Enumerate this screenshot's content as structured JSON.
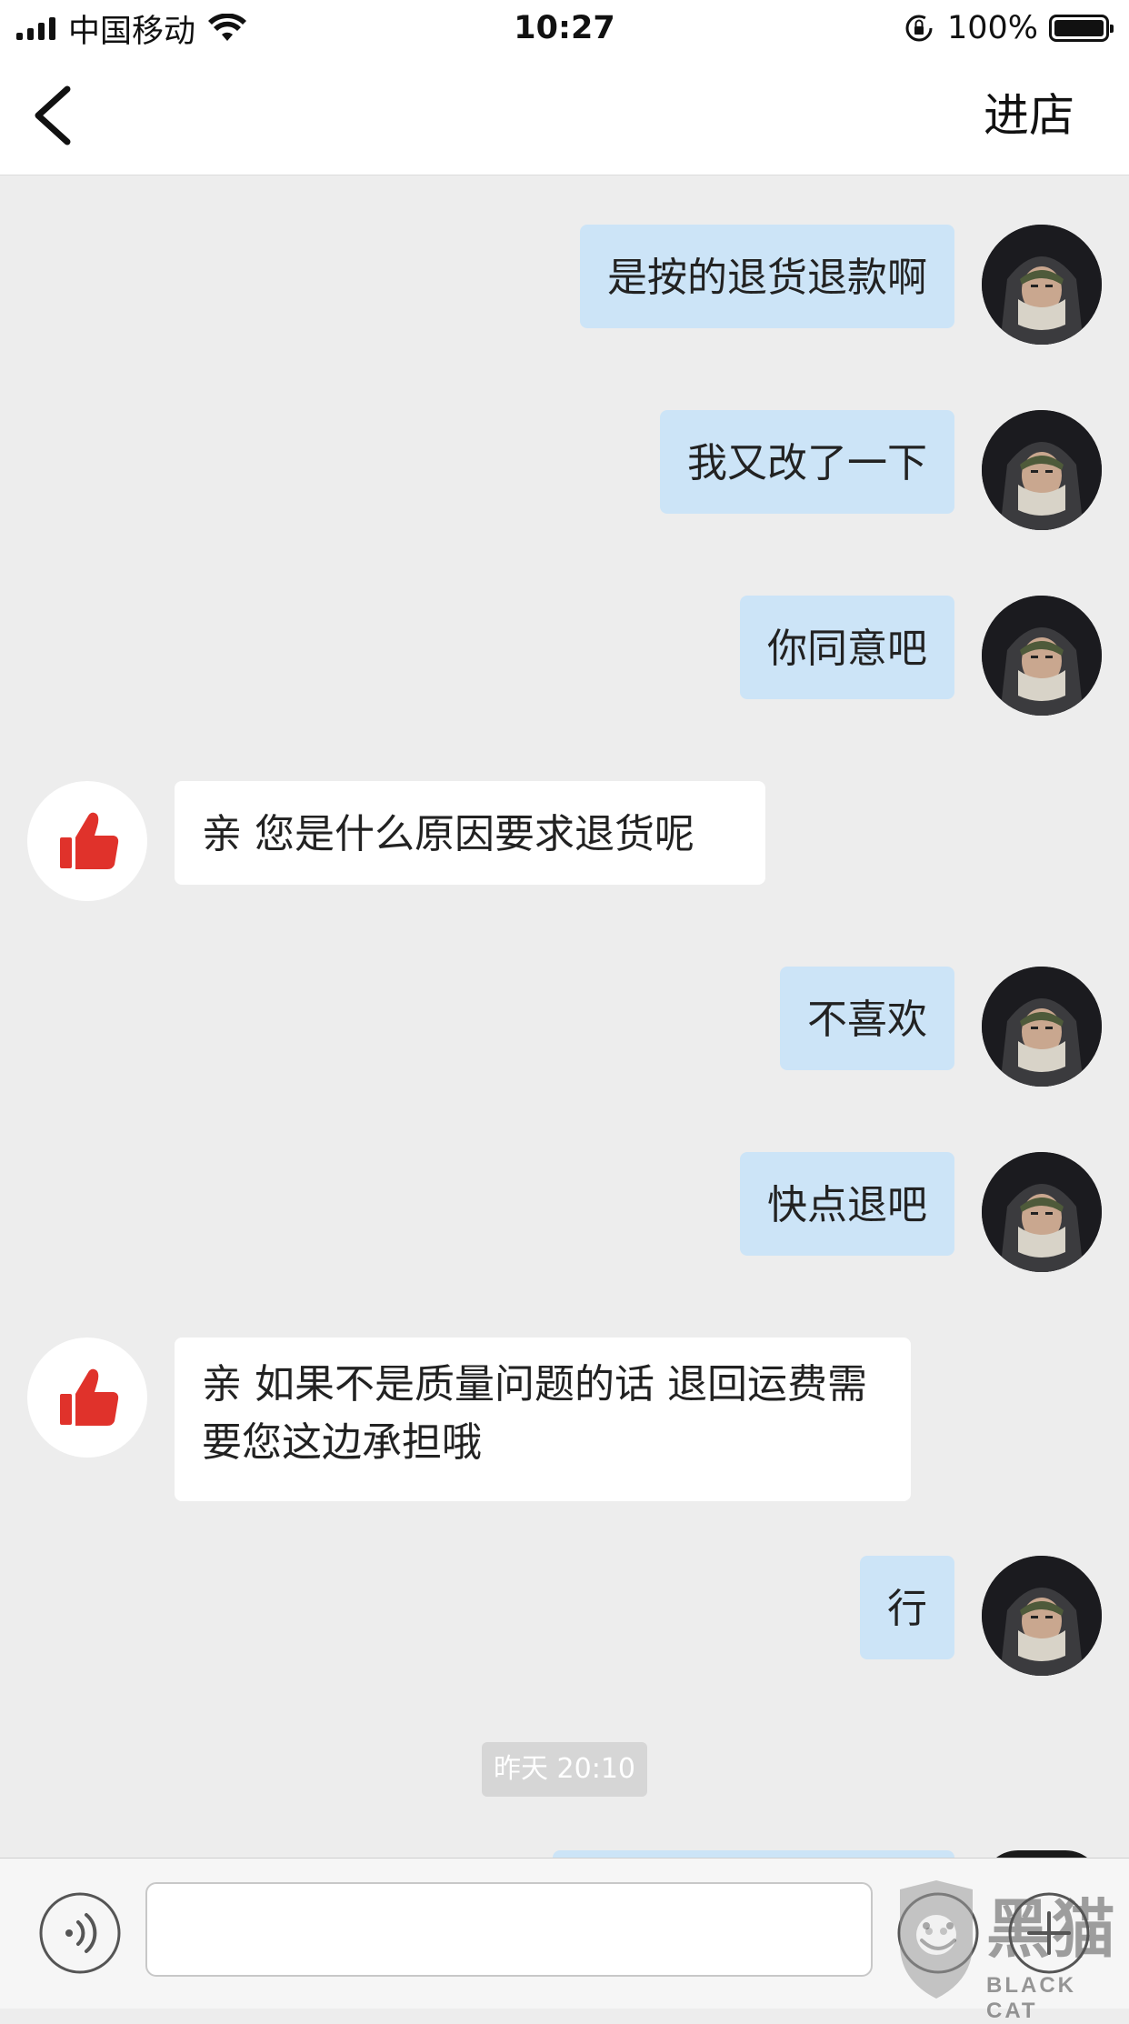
{
  "status_bar": {
    "carrier": "中国移动",
    "time": "10:27",
    "battery": "100%"
  },
  "nav": {
    "back_icon": "chevron-left-icon",
    "right_action": "进店"
  },
  "messages": [
    {
      "side": "me",
      "text": "是按的退货退款啊"
    },
    {
      "side": "me",
      "text": "我又改了一下"
    },
    {
      "side": "me",
      "text": "你同意吧"
    },
    {
      "side": "shop",
      "text": "亲 您是什么原因要求退货呢"
    },
    {
      "side": "me",
      "text": "不喜欢"
    },
    {
      "side": "me",
      "text": "快点退吧"
    },
    {
      "side": "shop",
      "text": "亲 如果不是质量问题的话 退回运费需要您这边承担哦"
    },
    {
      "side": "me",
      "text": "行"
    }
  ],
  "timestamp": "昨天 20:10",
  "input_bar": {
    "voice_icon": "voice-icon",
    "input_value": "",
    "emoji_icon": "emoji-icon",
    "plus_icon": "plus-icon"
  },
  "watermark": {
    "text": "黑猫",
    "sub": "BLACK CAT"
  },
  "colors": {
    "background": "#ededed",
    "my_bubble": "#cce4f7",
    "shop_bubble": "#ffffff",
    "shop_avatar_icon": "#e0322b"
  }
}
